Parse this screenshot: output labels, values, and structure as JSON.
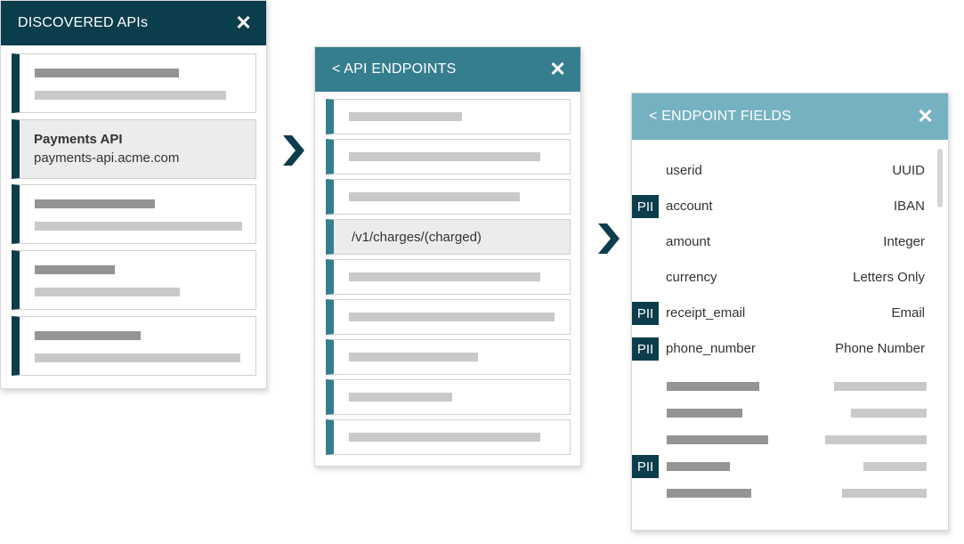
{
  "panel1": {
    "title": "DISCOVERED APIs",
    "close": "✕",
    "selected_name": "Payments API",
    "selected_host": "payments-api.acme.com"
  },
  "panel2": {
    "title": "< API ENDPOINTS",
    "close": "✕",
    "selected_endpoint": "/v1/charges/(charged)"
  },
  "panel3": {
    "title": "< ENDPOINT FIELDS",
    "close": "✕",
    "pii_label": "PII",
    "fields": [
      {
        "name": "userid",
        "type": "UUID",
        "pii": false
      },
      {
        "name": "account",
        "type": "IBAN",
        "pii": true
      },
      {
        "name": "amount",
        "type": "Integer",
        "pii": false
      },
      {
        "name": "currency",
        "type": "Letters Only",
        "pii": false
      },
      {
        "name": "receipt_email",
        "type": "Email",
        "pii": true
      },
      {
        "name": "phone_number",
        "type": "Phone Number",
        "pii": true
      }
    ],
    "placeholder_pii": [
      false,
      false,
      false,
      true,
      false
    ]
  },
  "colors": {
    "panel1_header": "#0c3d4c",
    "panel2_header": "#357e8f",
    "panel3_header": "#74b2c1",
    "pii_badge": "#0c3d4c"
  },
  "icons": {
    "close": "close-icon",
    "next": "chevron-right-icon"
  }
}
